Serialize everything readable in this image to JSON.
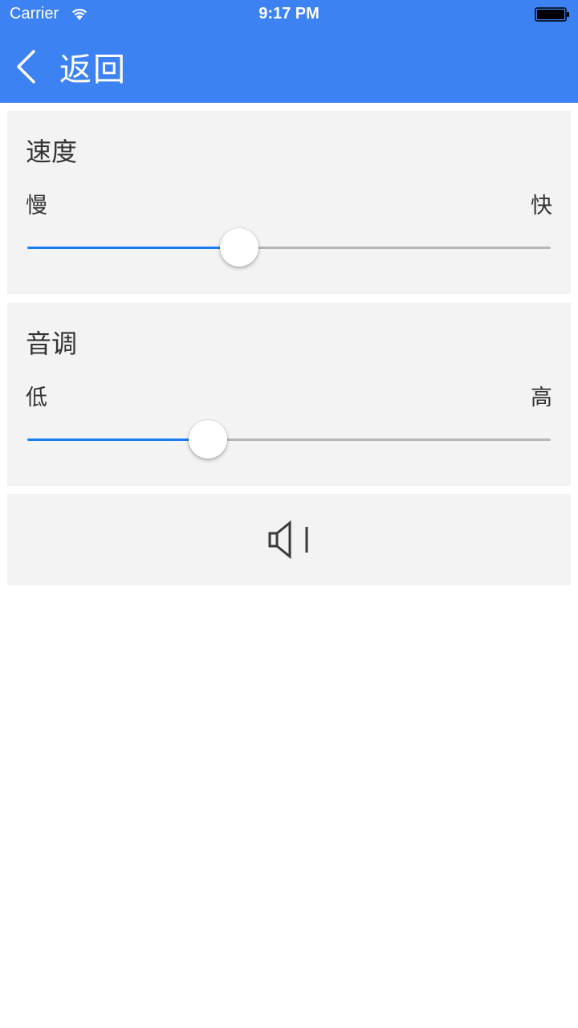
{
  "status_bar": {
    "carrier": "Carrier",
    "time": "9:17 PM",
    "wifi_icon": "wifi-icon",
    "battery_icon": "battery-icon"
  },
  "nav": {
    "back_icon": "chevron-left-icon",
    "back_label": "返回"
  },
  "speed": {
    "title": "速度",
    "min_label": "慢",
    "max_label": "快",
    "value_fraction": 0.405
  },
  "pitch": {
    "title": "音调",
    "min_label": "低",
    "max_label": "高",
    "value_fraction": 0.345
  },
  "play": {
    "icon": "speaker-icon"
  },
  "colors": {
    "header_bg": "#3d82f2",
    "card_bg": "#f3f3f3",
    "slider_active": "#1a7cf0",
    "slider_inactive": "#b8b8b8",
    "text": "#333333"
  }
}
